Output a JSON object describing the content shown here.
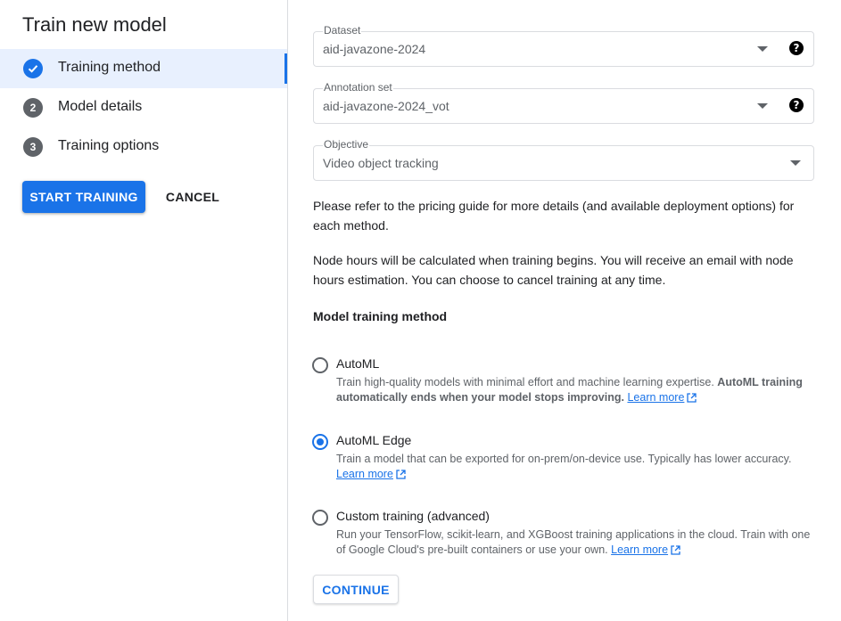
{
  "sidebar": {
    "title": "Train new model",
    "steps": [
      {
        "number": "",
        "label": "Training method",
        "state": "completed",
        "icon": "check-icon"
      },
      {
        "number": "2",
        "label": "Model details",
        "state": "pending"
      },
      {
        "number": "3",
        "label": "Training options",
        "state": "pending"
      }
    ],
    "start_training_label": "START TRAINING",
    "cancel_label": "CANCEL"
  },
  "form": {
    "dataset": {
      "label": "Dataset",
      "value": "aid-javazone-2024"
    },
    "annotation_set": {
      "label": "Annotation set",
      "value": "aid-javazone-2024_vot"
    },
    "objective": {
      "label": "Objective",
      "value": "Video object tracking"
    },
    "help_icon": "?"
  },
  "info": {
    "pricing": "Please refer to the pricing guide for more details (and available deployment options) for each method.",
    "node_hours": "Node hours will be calculated when training begins. You will receive an email with node hours estimation. You can choose to cancel training at any time."
  },
  "method": {
    "heading": "Model training method",
    "selected": "AutoML Edge",
    "options": [
      {
        "title": "AutoML",
        "desc_plain": "Train high-quality models with minimal effort and machine learning expertise. ",
        "desc_bold": "AutoML training automatically ends when your model stops improving.",
        "learn_more": "Learn more",
        "checked": false
      },
      {
        "title": "AutoML Edge",
        "desc_plain": "Train a model that can be exported for on-prem/on-device use. Typically has lower accuracy.",
        "learn_more": "Learn more",
        "checked": true
      },
      {
        "title": "Custom training (advanced)",
        "desc_plain": "Run your TensorFlow, scikit-learn, and XGBoost training applications in the cloud. Train with one of Google Cloud's pre-built containers or use your own.",
        "learn_more": "Learn more",
        "checked": false
      }
    ],
    "continue_label": "CONTINUE"
  },
  "colors": {
    "accent": "#1a73e8",
    "active_step_bg": "#e8f0fe",
    "border": "#dadce0",
    "muted_text": "#5f6368"
  }
}
